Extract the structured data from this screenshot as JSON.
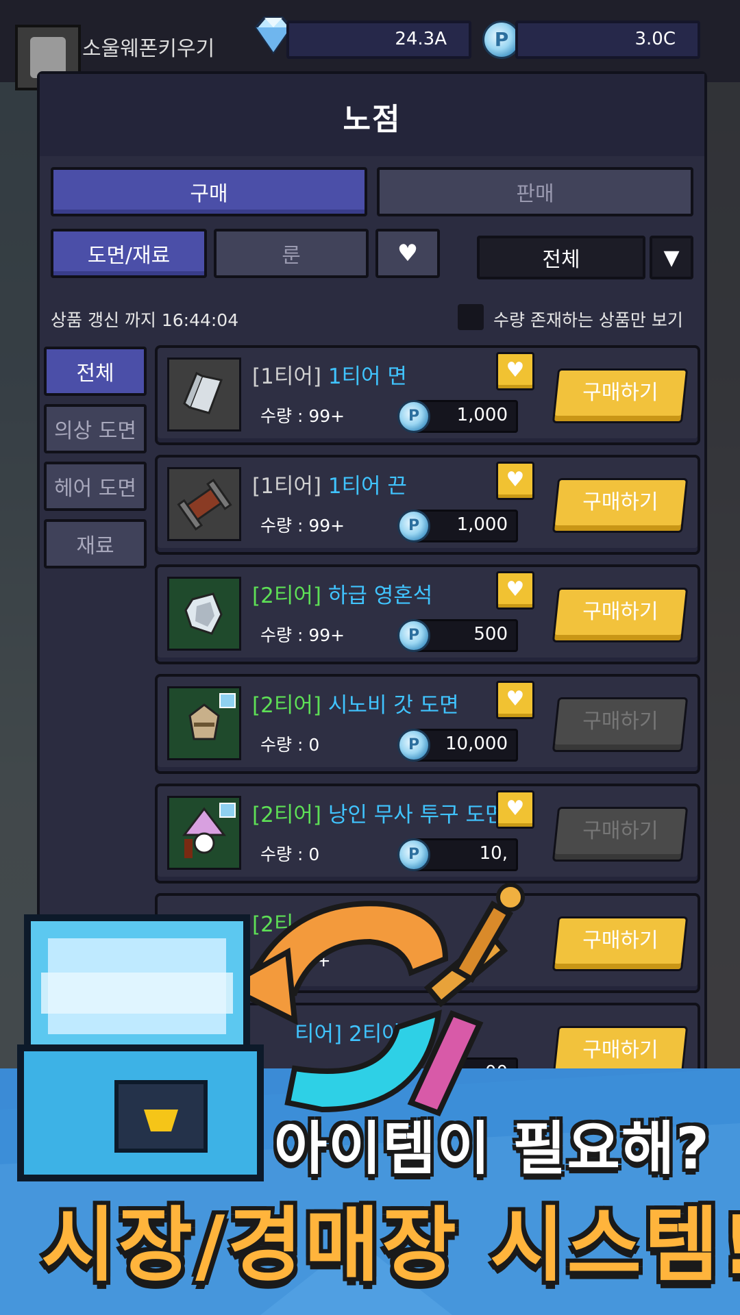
{
  "player": {
    "name": "소울웨폰키우기"
  },
  "resources": {
    "gems": "24.3A",
    "coins": "3.0C",
    "coin_symbol": "P"
  },
  "shop": {
    "title": "노점",
    "tabs": {
      "buy": "구매",
      "sell": "판매"
    },
    "subtabs": {
      "blueprint": "도면/재료",
      "rune": "룬",
      "heart": "♥"
    },
    "filter": {
      "selected": "전체",
      "arrow": "▼"
    },
    "refresh_text": "상품 갱신 까지 16:44:04",
    "in_stock_label": "수량 존재하는 상품만 보기",
    "categories": [
      "전체",
      "의상 도면",
      "헤어 도면",
      "재료"
    ],
    "items": [
      {
        "tier": "[1티어]",
        "name": "1티어 면",
        "qty": "수량 : 99+",
        "price": "1,000",
        "buy": "구매하기"
      },
      {
        "tier": "[1티어]",
        "name": "1티어 끈",
        "qty": "수량 : 99+",
        "price": "1,000",
        "buy": "구매하기"
      },
      {
        "tier": "[2티어]",
        "name": "하급 영혼석",
        "qty": "수량 : 99+",
        "price": "500",
        "buy": "구매하기"
      },
      {
        "tier": "[2티어]",
        "name": "시노비 갓 도면",
        "qty": "수량 : 0",
        "price": "10,000",
        "buy": "구매하기"
      },
      {
        "tier": "[2티어]",
        "name": "낭인 무사 투구 도면",
        "qty": "수량 : 0",
        "price": "10,",
        "buy": "구매하기"
      },
      {
        "tier": "[2티",
        "name": "",
        "qty": "99+",
        "price": "",
        "buy": "구매하기"
      },
      {
        "tier": "",
        "name": "티어] 2티아",
        "qty": "",
        "price": "00",
        "buy": "구매하기"
      }
    ]
  },
  "banner": {
    "line1": "아이템이 필요해?",
    "line2": "시장/경매장 시스템!"
  }
}
